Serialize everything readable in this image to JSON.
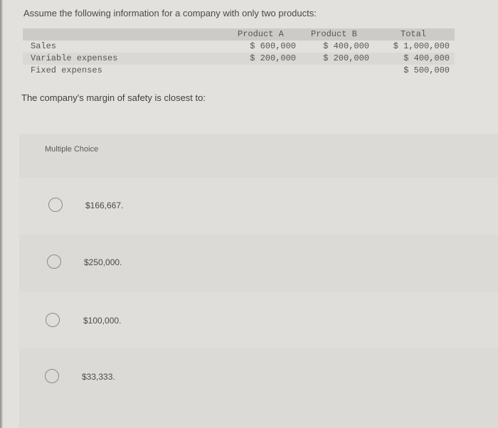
{
  "intro": "Assume the following information for a company with only two products:",
  "table": {
    "headers": [
      "Product A",
      "Product B",
      "Total"
    ],
    "rows": [
      {
        "label": "Sales",
        "a": "$ 600,000",
        "b": "$ 400,000",
        "total": "$ 1,000,000"
      },
      {
        "label": "Variable expenses",
        "a": "$ 200,000",
        "b": "$ 200,000",
        "total": "$ 400,000"
      },
      {
        "label": "Fixed expenses",
        "a": "",
        "b": "",
        "total": "$ 500,000"
      }
    ]
  },
  "question": "The company's margin of safety is closest to:",
  "multiple_choice": {
    "title": "Multiple Choice",
    "options": [
      {
        "label": "$166,667.",
        "selected": false
      },
      {
        "label": "$250,000.",
        "selected": false
      },
      {
        "label": "$100,000.",
        "selected": false
      },
      {
        "label": "$33,333.",
        "selected": false
      }
    ]
  }
}
